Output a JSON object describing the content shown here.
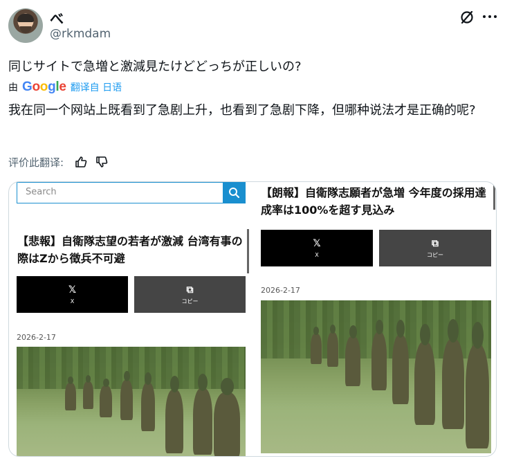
{
  "user": {
    "display_name": "べ",
    "handle": "@rkmdam"
  },
  "tweet": {
    "text": "同じサイトで急増と激減見たけどどっちが正しいの?",
    "translate_by": "由",
    "translate_provider": "Google",
    "translate_link": "翻译自 日语",
    "translated_text": "我在同一个网站上既看到了急剧上升，也看到了急剧下降，但哪种说法才是正确的呢?",
    "rate_label": "评价此翻译:"
  },
  "media": {
    "left": {
      "search_placeholder": "Search",
      "headline": "【悲報】自衛隊志望の若者が激減 台湾有事の際はZから徴兵不可避",
      "x_glyph": "𝕏",
      "x_label": "X",
      "copy_glyph": "⧉",
      "copy_label": "コピー",
      "date": "2026-2-17"
    },
    "right": {
      "headline": "【朗報】自衛隊志願者が急増 今年度の採用達成率は100%を超す見込み",
      "x_glyph": "𝕏",
      "x_label": "X",
      "copy_glyph": "⧉",
      "copy_label": "コピー",
      "date": "2026-2-17"
    }
  },
  "colors": {
    "link": "#1d9bf0",
    "search_accent": "#1a8fcf",
    "border": "#cfd9de"
  }
}
